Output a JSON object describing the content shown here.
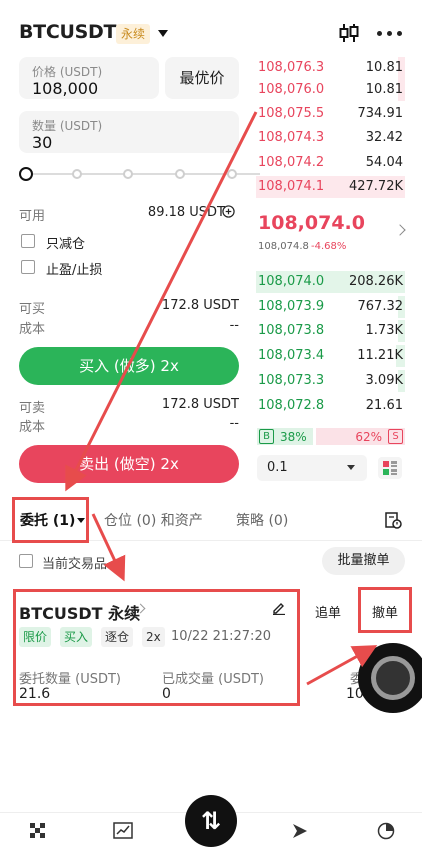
{
  "header": {
    "pair": "BTCUSDT",
    "badge": "永续"
  },
  "form": {
    "price_label": "价格 (USDT)",
    "price_value": "108,000",
    "best_price": "最优价",
    "qty_label": "数量 (USDT)",
    "qty_value": "30",
    "available_label": "可用",
    "available_value": "89.18 USDT",
    "reduce_only": "只减仓",
    "tp_sl": "止盈/止损",
    "can_buy_label": "可买",
    "can_buy_value": "172.8 USDT",
    "cost_label": "成本",
    "cost_value": "--",
    "buy_button": "买入 (做多) 2x",
    "can_sell_label": "可卖",
    "can_sell_value": "172.8 USDT",
    "sell_cost_label": "成本",
    "sell_cost_value": "--",
    "sell_button": "卖出 (做空) 2x"
  },
  "orderbook": {
    "asks": [
      {
        "price": "108,076.3",
        "qty": "10.81",
        "depth": 0.05
      },
      {
        "price": "108,076.0",
        "qty": "10.81",
        "depth": 0.05
      },
      {
        "price": "108,075.5",
        "qty": "734.91",
        "depth": 0.0
      },
      {
        "price": "108,074.3",
        "qty": "32.42",
        "depth": 0.0
      },
      {
        "price": "108,074.2",
        "qty": "54.04",
        "depth": 0.0
      },
      {
        "price": "108,074.1",
        "qty": "427.72K",
        "depth": 1.0
      }
    ],
    "last_price": "108,074.0",
    "mark_price": "108,074.8",
    "change": "-4.68%",
    "bids": [
      {
        "price": "108,074.0",
        "qty": "208.26K",
        "depth": 1.0
      },
      {
        "price": "108,073.9",
        "qty": "767.32",
        "depth": 0.05
      },
      {
        "price": "108,073.8",
        "qty": "1.73K",
        "depth": 0.05
      },
      {
        "price": "108,073.4",
        "qty": "11.21K",
        "depth": 0.06
      },
      {
        "price": "108,073.3",
        "qty": "3.09K",
        "depth": 0.05
      },
      {
        "price": "108,072.8",
        "qty": "21.61",
        "depth": 0.0
      }
    ],
    "buy_ratio_label": "38%",
    "sell_ratio_label": "62%",
    "buy_ratio": 0.38,
    "sell_ratio": 0.62,
    "b_tag": "B",
    "s_tag": "S",
    "depth_value": "0.1"
  },
  "tabs": {
    "orders": "委托 (1)",
    "positions": "仓位 (0) 和资产",
    "strategy": "策略 (0)"
  },
  "filters": {
    "current_pair": "当前交易品",
    "batch_cancel": "批量撤单"
  },
  "order": {
    "title": "BTCUSDT 永续",
    "chase": "追单",
    "cancel": "撤单",
    "tag_limit": "限价",
    "tag_buy": "买入",
    "tag_isolated": "逐仓",
    "tag_leverage": "2x",
    "time": "10/22 21:27:20",
    "qty_label": "委托数量 (USDT)",
    "qty_value": "21.6",
    "filled_label": "已成交量 (USDT)",
    "filled_value": "0",
    "cut_label": "委",
    "cut_value": "10"
  },
  "colors": {
    "green": "#2bb459",
    "red": "#e8455d",
    "annotation": "#e74c4c"
  }
}
